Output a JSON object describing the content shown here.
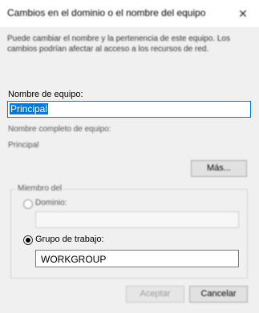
{
  "window": {
    "title": "Cambios en el dominio o el nombre del equipo",
    "close_glyph": "✕"
  },
  "description": "Puede cambiar el nombre y la pertenencia de este equipo. Los cambios podrían afectar al acceso a los recursos de red.",
  "computer_name": {
    "label": "Nombre de equipo:",
    "value": "Principal"
  },
  "full_name": {
    "label": "Nombre completo de equipo:",
    "value": "Principal"
  },
  "more_button": "Más...",
  "member_of": {
    "label": "Miembro del",
    "domain_label": "Dominio:",
    "domain_value": "",
    "domain_selected": false,
    "workgroup_label": "Grupo de trabajo:",
    "workgroup_value": "WORKGROUP",
    "workgroup_selected": true
  },
  "buttons": {
    "accept": "Aceptar",
    "cancel": "Cancelar"
  }
}
